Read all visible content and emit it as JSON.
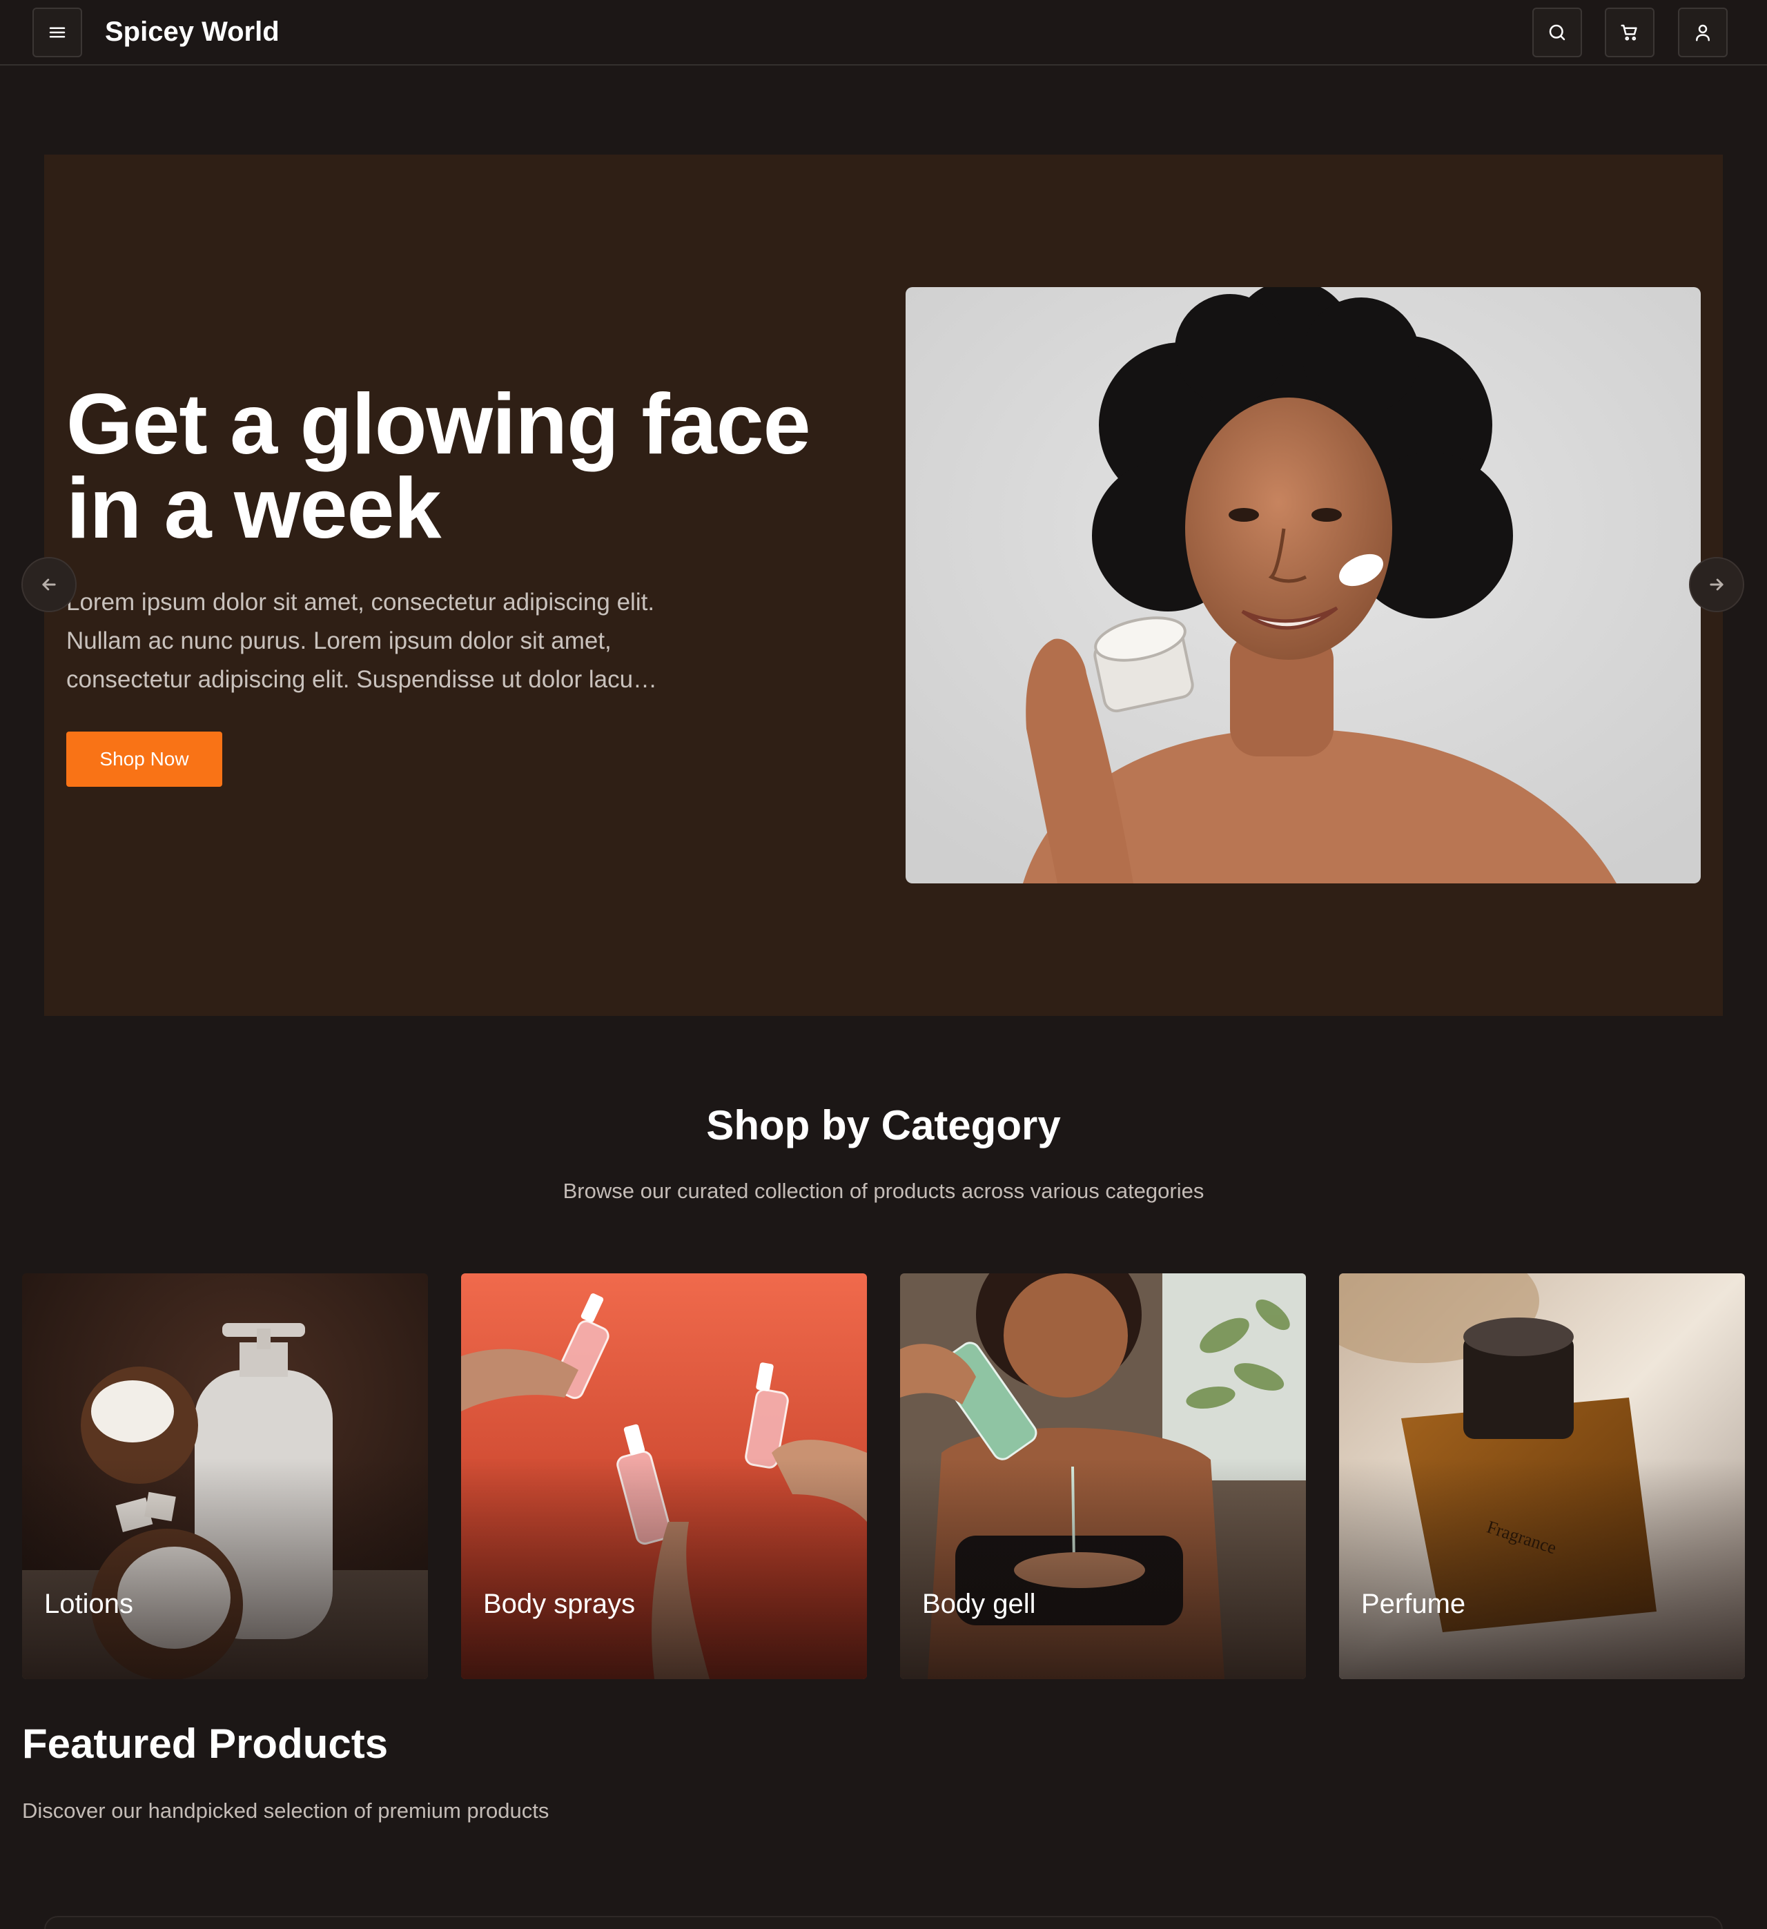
{
  "header": {
    "brand": "Spicey World",
    "icons": [
      "menu-icon",
      "search-icon",
      "cart-icon",
      "user-icon"
    ]
  },
  "hero": {
    "title": "Get a glowing face in a week",
    "description": "Lorem ipsum dolor sit amet, consectetur adipiscing elit. Nullam ac nunc purus. Lorem ipsum dolor sit amet, consectetur adipiscing elit. Suspendisse ut dolor lacu…",
    "cta_label": "Shop Now"
  },
  "categories": {
    "title": "Shop by Category",
    "subtitle": "Browse our curated collection of products across various categories",
    "items": [
      {
        "label": "Lotions"
      },
      {
        "label": "Body sprays"
      },
      {
        "label": "Body gell"
      },
      {
        "label": "Perfume"
      }
    ]
  },
  "featured": {
    "title": "Featured Products",
    "subtitle": "Discover our handpicked selection of premium products"
  },
  "colors": {
    "background": "#1c1716",
    "hero_background": "#2f1f15",
    "accent": "#f97316"
  }
}
